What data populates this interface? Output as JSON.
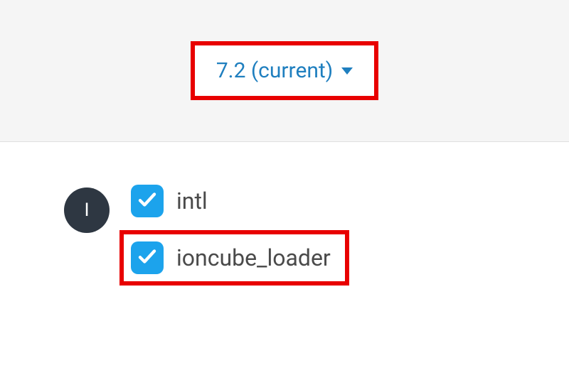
{
  "version_selector": {
    "label": "7.2 (current)"
  },
  "section_letter": "I",
  "extensions": [
    {
      "name": "intl",
      "checked": true,
      "highlighted": false
    },
    {
      "name": "ioncube_loader",
      "checked": true,
      "highlighted": true
    }
  ]
}
